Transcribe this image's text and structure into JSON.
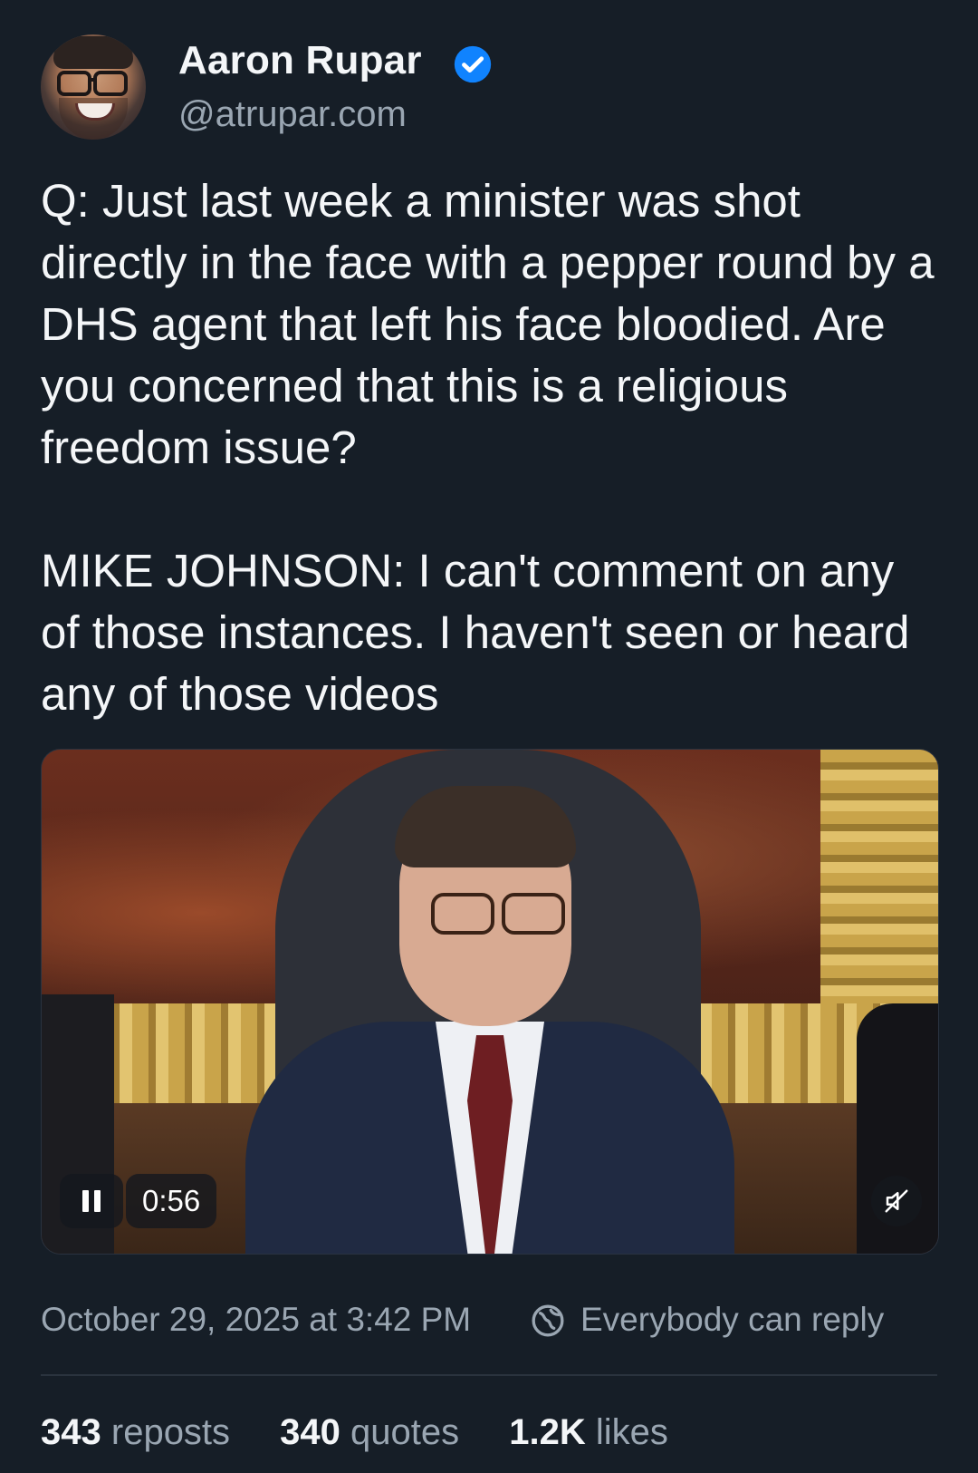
{
  "author": {
    "name": "Aaron Rupar",
    "handle": "@atrupar.com",
    "verified_icon": "verified-badge-icon",
    "verified_color": "#1083fe"
  },
  "post": {
    "text": "Q: Just last week a minister was shot directly in the face with a pepper round by a DHS agent that left his face bloodied. Are you concerned that this is a religious freedom issue?\n\nMIKE JOHNSON: I can't comment on any of those instances. I haven't seen or heard any of those videos"
  },
  "video": {
    "duration": "0:56",
    "pause_icon": "pause-icon",
    "mute_icon": "muted-speaker-icon"
  },
  "meta": {
    "date": "October 29, 2025 at 3:42 PM",
    "reply_setting": "Everybody can reply",
    "reply_icon": "globe-icon"
  },
  "stats": [
    {
      "count": "343",
      "label": "reposts"
    },
    {
      "count": "340",
      "label": "quotes"
    },
    {
      "count": "1.2K",
      "label": "likes"
    }
  ],
  "colors": {
    "background": "#161e27",
    "text_primary": "#f4f6f8",
    "text_secondary": "#9aa6b2"
  }
}
